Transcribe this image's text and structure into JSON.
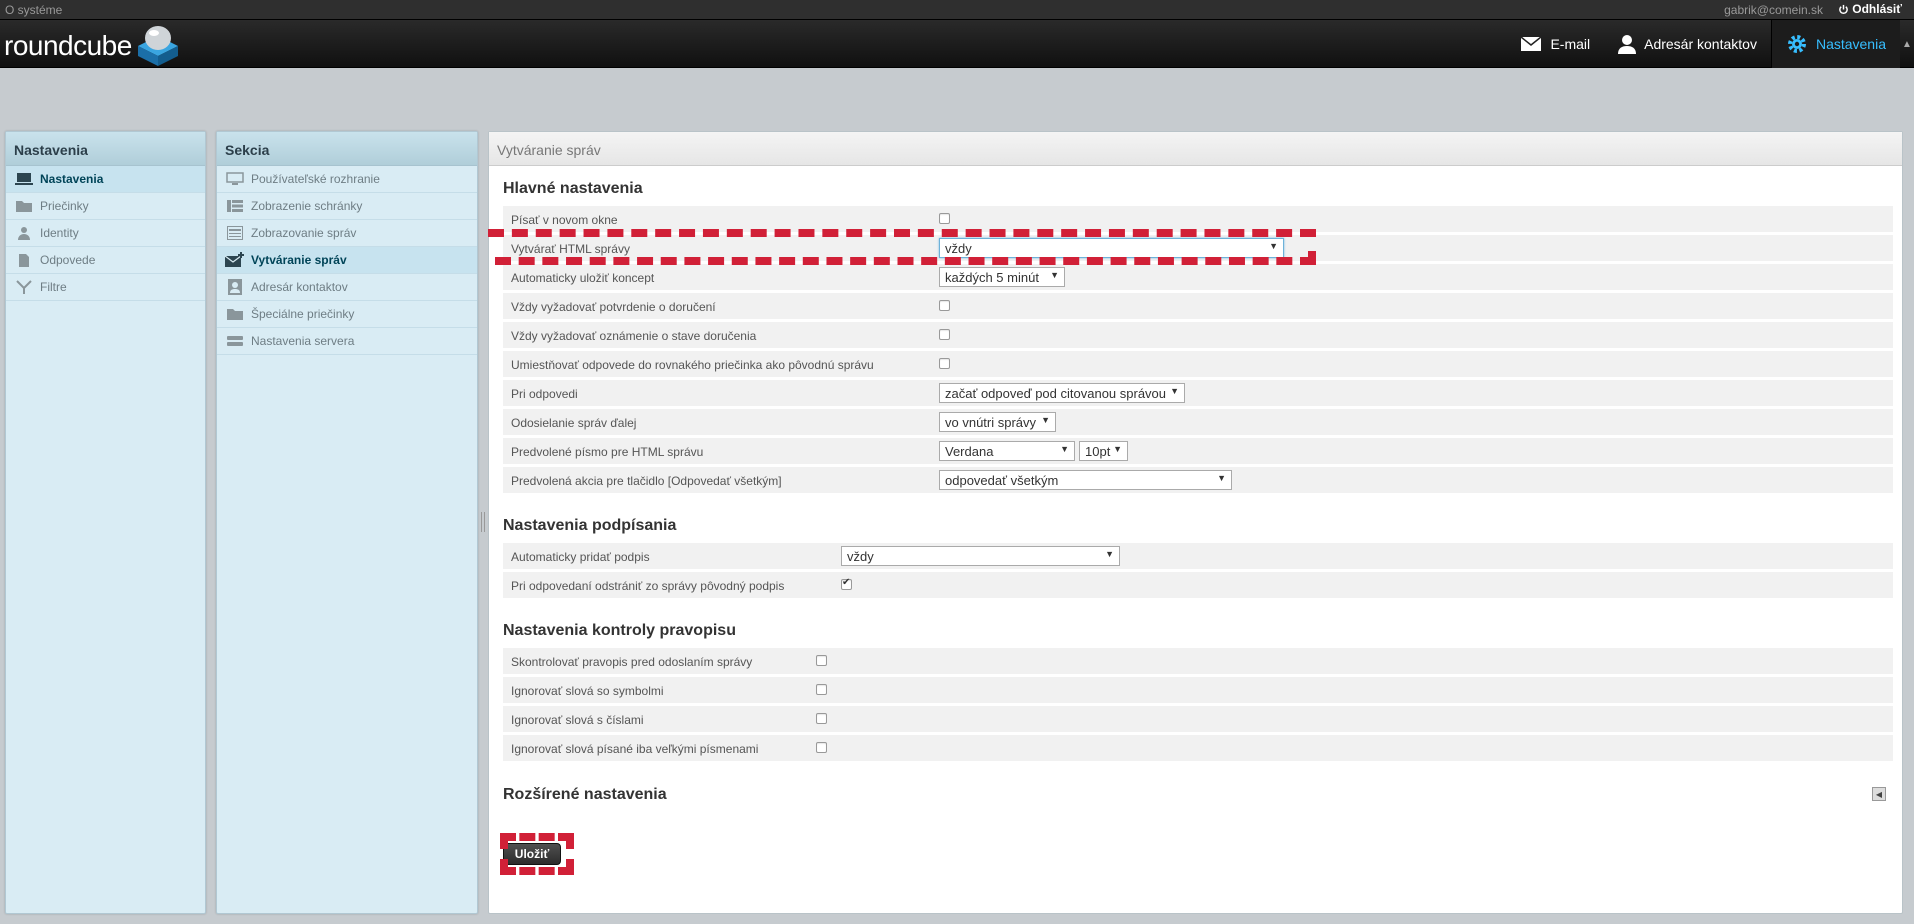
{
  "topline": {
    "about": "O systéme",
    "user": "gabrik@comein.sk",
    "logout": "Odhlásiť"
  },
  "logo": {
    "text": "roundcube"
  },
  "nav": {
    "email": "E-mail",
    "addressbook": "Adresár kontaktov",
    "settings": "Nastavenia"
  },
  "settings_panel": {
    "title": "Nastavenia",
    "items": [
      {
        "label": "Nastavenia",
        "icon": "monitor-icon",
        "selected": true
      },
      {
        "label": "Priečinky",
        "icon": "folder-icon"
      },
      {
        "label": "Identity",
        "icon": "person-icon"
      },
      {
        "label": "Odpovede",
        "icon": "document-icon"
      },
      {
        "label": "Filtre",
        "icon": "filter-icon"
      }
    ]
  },
  "section_panel": {
    "title": "Sekcia",
    "items": [
      {
        "label": "Používateľské rozhranie",
        "icon": "monitor-icon"
      },
      {
        "label": "Zobrazenie schránky",
        "icon": "list-icon"
      },
      {
        "label": "Zobrazovanie správ",
        "icon": "message-view-icon"
      },
      {
        "label": "Vytváranie správ",
        "icon": "compose-icon",
        "selected": true
      },
      {
        "label": "Adresár kontaktov",
        "icon": "contact-icon"
      },
      {
        "label": "Špeciálne priečinky",
        "icon": "folder-icon"
      },
      {
        "label": "Nastavenia servera",
        "icon": "server-icon"
      }
    ]
  },
  "content": {
    "header": "Vytváranie správ",
    "main_title": "Hlavné nastavenia",
    "main_rows": [
      {
        "label": "Písať v novom okne"
      },
      {
        "label": "Vytvárať HTML správy",
        "select": "vždy"
      },
      {
        "label": "Automaticky uložiť koncept",
        "select": "každých 5 minút"
      },
      {
        "label": "Vždy vyžadovať potvrdenie o doručení"
      },
      {
        "label": "Vždy vyžadovať oznámenie o stave doručenia"
      },
      {
        "label": "Umiestňovať odpovede do rovnakého priečinka ako pôvodnú správu"
      },
      {
        "label": "Pri odpovedi",
        "select": "začať odpoveď pod citovanou správou"
      },
      {
        "label": "Odosielanie správ ďalej",
        "select": "vo vnútri správy"
      },
      {
        "label": "Predvolené písmo pre HTML správu",
        "select": "Verdana",
        "select2": "10pt"
      },
      {
        "label": "Predvolená akcia pre tlačidlo [Odpovedať všetkým]",
        "select": "odpovedať všetkým"
      }
    ],
    "sign_title": "Nastavenia podpísania",
    "sign_rows": [
      {
        "label": "Automaticky pridať podpis",
        "select": "vždy"
      },
      {
        "label": "Pri odpovedaní odstrániť zo správy pôvodný podpis",
        "checked": true
      }
    ],
    "spell_title": "Nastavenia kontroly pravopisu",
    "spell_rows": [
      {
        "label": "Skontrolovať pravopis pred odoslaním správy"
      },
      {
        "label": "Ignorovať slová so symbolmi"
      },
      {
        "label": "Ignorovať slová s číslami"
      },
      {
        "label": "Ignorovať slová písané iba veľkými písmenami"
      }
    ],
    "adv_title": "Rozšírené nastavenia",
    "save": "Uložiť"
  }
}
